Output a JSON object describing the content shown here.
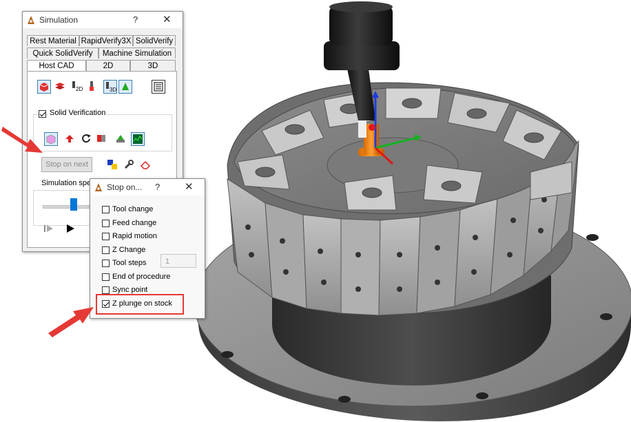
{
  "simulation_dialog": {
    "title": "Simulation",
    "help": "?",
    "close": "✕",
    "tabs_row1": [
      "Rest Material",
      "RapidVerify3X",
      "SolidVerify"
    ],
    "tabs_row2": [
      "Quick SolidVerify",
      "Machine Simulation"
    ],
    "tabs_row3": [
      "Host CAD",
      "2D",
      "3D"
    ],
    "active_tab": "Host CAD",
    "solid_verification_label": "Solid Verification",
    "solid_verification_checked": true,
    "stop_on_next_label": "Stop on next",
    "simulation_speed_label": "Simulation speed",
    "speed_level": 0.4
  },
  "stop_on_dialog": {
    "title": "Stop on...",
    "help": "?",
    "close": "✕",
    "options": [
      {
        "label": "Tool change",
        "checked": false
      },
      {
        "label": "Feed change",
        "checked": false
      },
      {
        "label": "Rapid motion",
        "checked": false
      },
      {
        "label": "Z Change",
        "checked": false
      },
      {
        "label": "Tool steps",
        "checked": false
      },
      {
        "label": "End of procedure",
        "checked": false
      },
      {
        "label": "Sync point",
        "checked": false
      },
      {
        "label": "Z plunge on stock",
        "checked": true
      }
    ],
    "tool_steps_value": "1"
  },
  "colors": {
    "highlight_box": "#e53935",
    "arrow": "#e53935",
    "part_gray": "#9a9a9a",
    "tool_black": "#222222"
  }
}
